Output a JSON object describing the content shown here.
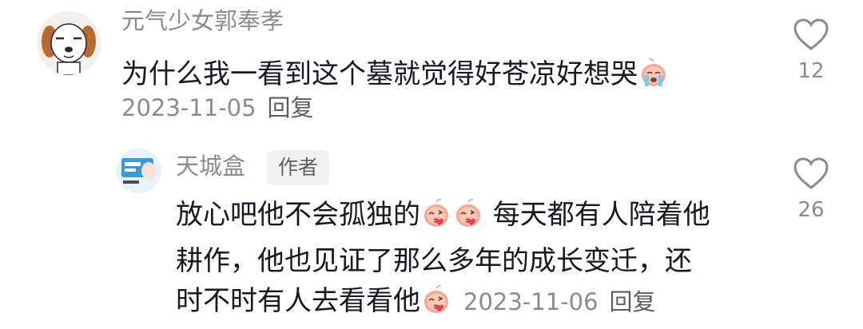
{
  "comment": {
    "username": "元气少女郭奉孝",
    "text": "为什么我一看到这个墓就觉得好苍凉好想哭",
    "emoji": "crying-peach-emoji",
    "date": "2023-11-05",
    "reply_label": "回复",
    "like_count": "12"
  },
  "reply": {
    "username": "天城盒",
    "badge": "作者",
    "line1_a": "放心吧他不会孤独的",
    "line1_b": " 每天都有人陪着他",
    "line2": "耕作，他也见证了那么多年的成长变迁，还",
    "line3": "时不时有人去看看他",
    "emoji": "kissing-peach-emoji",
    "date": "2023-11-06",
    "reply_label": "回复",
    "like_count": "26"
  },
  "colors": {
    "primary_text": "#161823",
    "secondary_text": "#8a8b91",
    "badge_bg": "#f1f1f2"
  }
}
